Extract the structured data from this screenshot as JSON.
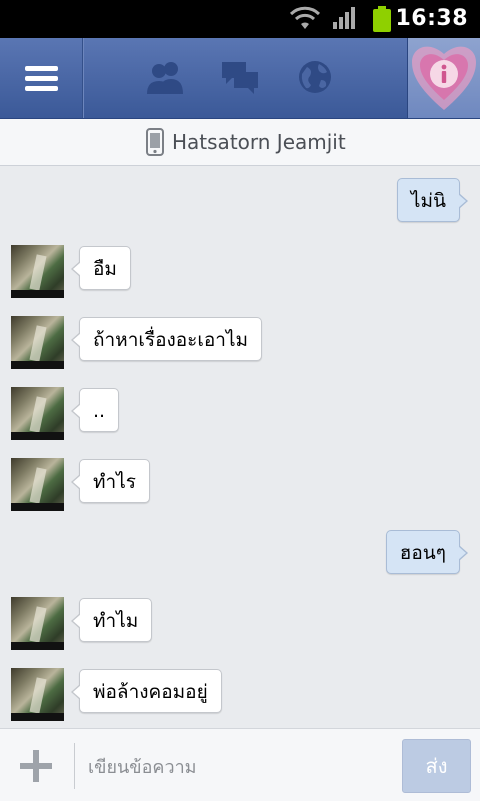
{
  "status_bar": {
    "time": "16:38"
  },
  "thread": {
    "contact_name": "Hatsatorn Jeamjit"
  },
  "messages": [
    {
      "side": "right",
      "text": "ไม่นิ"
    },
    {
      "side": "left",
      "text": "อืม"
    },
    {
      "side": "left",
      "text": "ถ้าหาเรื่องอะเอาไม"
    },
    {
      "side": "left",
      "text": ".."
    },
    {
      "side": "left",
      "text": "ทำไร"
    },
    {
      "side": "right",
      "text": "ฮอนๆ"
    },
    {
      "side": "left",
      "text": "ทำไม"
    },
    {
      "side": "left",
      "text": "พ่อล้างคอมอยู่"
    }
  ],
  "composer": {
    "placeholder": "เขียนข้อความ",
    "value": "",
    "send_label": "ส่ง"
  },
  "colors": {
    "topbar": "#3b5998",
    "outgoing_bubble": "#d5e4f5",
    "incoming_bubble": "#ffffff",
    "send_button": "#bccbe3",
    "background": "#e9ebee"
  },
  "icons": {
    "topbar": [
      "menu-icon",
      "friends-icon",
      "messages-icon",
      "globe-icon",
      "info-icon"
    ],
    "header": "phone-icon",
    "composer": "plus-icon"
  }
}
